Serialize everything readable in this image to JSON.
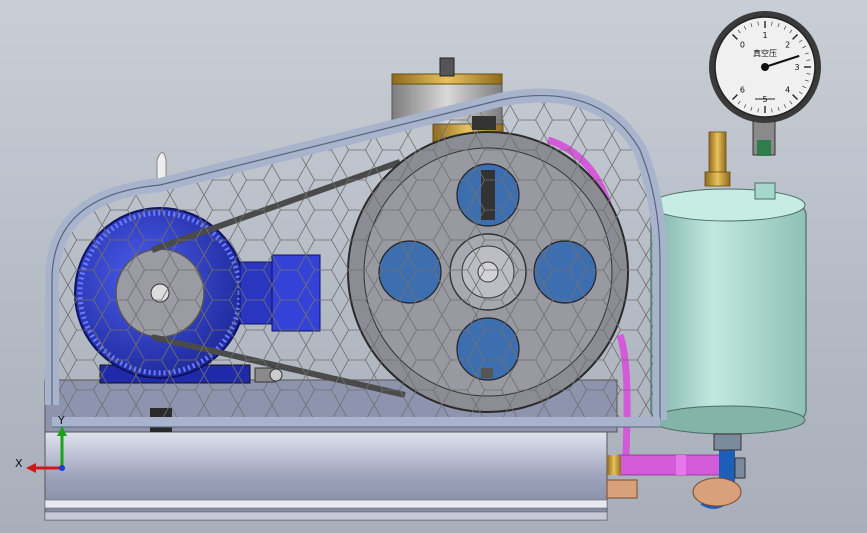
{
  "gauge": {
    "dial_numbers": [
      "0",
      "1",
      "2",
      "3",
      "4",
      "5",
      "6"
    ],
    "dial_label": "真空压",
    "needle_value": 2.6,
    "dial_max": 6
  },
  "axes_triad": {
    "y_label": "Y",
    "x_label": "X"
  },
  "colors": {
    "background": "#bcc2cb",
    "frame": "#a8b4cc",
    "motor": "#2233c8",
    "pulley": "#8c8c94",
    "tank": "#a9d6cc",
    "pipe": "#d260d8",
    "brass": "#c89a3c",
    "base": "#9aa0b8"
  }
}
